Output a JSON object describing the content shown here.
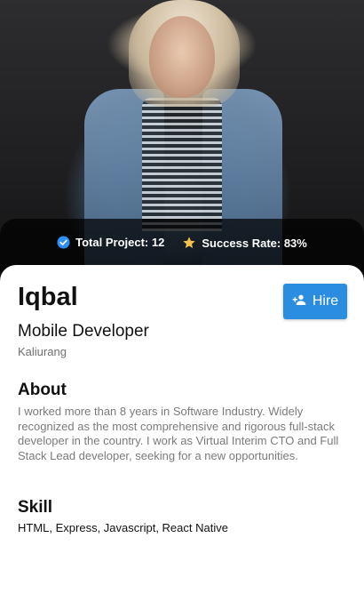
{
  "stats": {
    "projects_label": "Total Project: 12",
    "success_label": "Success Rate: 83%"
  },
  "profile": {
    "name": "Iqbal",
    "role": "Mobile Developer",
    "location": "Kaliurang"
  },
  "hire_button": {
    "label": "Hire",
    "icon": "person-add-icon"
  },
  "about": {
    "title": "About",
    "text": "I worked more than 8 years in Software Industry. Widely recognized as the most comprehensive and rigorous full-stack developer in the country. I work as Virtual Interim CTO and Full Stack Lead developer, seeking for a new opportunities."
  },
  "skill": {
    "title": "Skill",
    "text": "HTML, Express, Javascript, React Native"
  },
  "colors": {
    "accent": "#2a8de0",
    "verified": "#2f8ff0",
    "star": "#f5c24b"
  }
}
